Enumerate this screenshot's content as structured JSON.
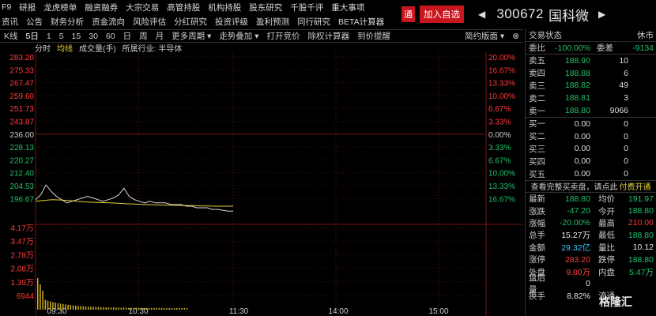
{
  "menu": {
    "row1": [
      "F9",
      "研报",
      "龙虎榜单",
      "融资融券",
      "大宗交易",
      "高管持股",
      "机构持股",
      "股东研究",
      "千股千评",
      "重大事项"
    ],
    "row2": [
      "资讯",
      "公告",
      "财务分析",
      "资金流向",
      "风险评估",
      "分红研究",
      "投资评级",
      "盈利预测",
      "同行研究",
      "BETA计算器"
    ]
  },
  "title": {
    "tong": "通",
    "add": "加入自选",
    "left_arrow": "◀",
    "right_arrow": "▶",
    "code": "300672",
    "name": "国科微"
  },
  "toolbar": {
    "items": [
      "K线",
      "5日",
      "1",
      "5",
      "15",
      "30",
      "60",
      "日",
      "周",
      "月",
      "更多周期 ▾",
      "走势叠加 ▾",
      "打开竞价",
      "除权计算器",
      "到价提醒"
    ],
    "layout": "简约版面 ▾",
    "close": "⊗"
  },
  "subbar": {
    "items": [
      "分时",
      "均线",
      "成交量(手)",
      "所属行业: 半导体"
    ]
  },
  "chart_data": {
    "type": "line",
    "y_ticks": [
      "283.20",
      "275.33",
      "267.47",
      "259.60",
      "251.73",
      "243.87",
      "236.00",
      "228.13",
      "220.27",
      "212.40",
      "204.53",
      "196.67"
    ],
    "pct_ticks": [
      "20.00%",
      "16.67%",
      "13.33%",
      "10.00%",
      "6.67%",
      "3.33%",
      "0.00%",
      "3.33%",
      "6.67%",
      "10.00%",
      "13.33%",
      "16.67%"
    ],
    "vol_ticks": [
      "4.17万",
      "3.47万",
      "2.78万",
      "2.08万",
      "1.39万",
      "6944"
    ],
    "x_ticks": [
      "09:30",
      "10:30",
      "11:30",
      "14:00",
      "15:00"
    ],
    "prev_close": 236.0,
    "ylim": [
      188.8,
      283.2
    ],
    "price": [
      196,
      199,
      205,
      201,
      198,
      196,
      194,
      195,
      196,
      197,
      198,
      197,
      196,
      195,
      196,
      197,
      199,
      203,
      198,
      196,
      195,
      194,
      195,
      194,
      194,
      194,
      193,
      193,
      193,
      192,
      192,
      191,
      191,
      191,
      190,
      190,
      189.5,
      189,
      189
    ],
    "avg": [
      195,
      195.5,
      196,
      195.8,
      195.5,
      195,
      194.6,
      194.4,
      194.2,
      194,
      193.8,
      193.5,
      193.3,
      193.1,
      192.9,
      192.7,
      192.6,
      192.5,
      192.4,
      192.3,
      192.2,
      192.1,
      192.0,
      192.0,
      191.97
    ],
    "volume_max": 41700
  },
  "rp": {
    "title": "交易状态",
    "status": "休市",
    "ratio_label": "委比",
    "ratio": "-100.00%",
    "diff_label": "委差",
    "diff": "-9134",
    "sells": [
      {
        "k": "卖五",
        "p": "188.90",
        "q": "10"
      },
      {
        "k": "卖四",
        "p": "188.88",
        "q": "6"
      },
      {
        "k": "卖三",
        "p": "188.82",
        "q": "49"
      },
      {
        "k": "卖二",
        "p": "188.81",
        "q": "3"
      },
      {
        "k": "卖一",
        "p": "188.80",
        "q": "9066"
      }
    ],
    "buys": [
      {
        "k": "买一",
        "p": "0.00",
        "q": "0"
      },
      {
        "k": "买二",
        "p": "0.00",
        "q": "0"
      },
      {
        "k": "买三",
        "p": "0.00",
        "q": "0"
      },
      {
        "k": "买四",
        "p": "0.00",
        "q": "0"
      },
      {
        "k": "买五",
        "p": "0.00",
        "q": "0"
      }
    ],
    "full_text": "查看完整买卖盘，请点此",
    "full_link": "付费开通",
    "stats": [
      {
        "k": "最新",
        "v": "188.80",
        "c": "grn",
        "k2": "均价",
        "v2": "191.97",
        "c2": "grn"
      },
      {
        "k": "涨跌",
        "v": "-47.20",
        "c": "grn",
        "k2": "今开",
        "v2": "188.80",
        "c2": "grn"
      },
      {
        "k": "涨幅",
        "v": "-20.00%",
        "c": "grn",
        "k2": "最高",
        "v2": "210.00",
        "c2": "red"
      },
      {
        "k": "总手",
        "v": "15.27万",
        "c": "wht",
        "k2": "最低",
        "v2": "188.80",
        "c2": "grn"
      },
      {
        "k": "金额",
        "v": "29.32亿",
        "c": "cy",
        "k2": "量比",
        "v2": "10.12",
        "c2": "wht"
      },
      {
        "k": "涨停",
        "v": "283.20",
        "c": "red",
        "k2": "跌停",
        "v2": "188.80",
        "c2": "grn"
      },
      {
        "k": "外盘",
        "v": "9.80万",
        "c": "red",
        "k2": "内盘",
        "v2": "5.47万",
        "c2": "grn"
      },
      {
        "k": "盘后量",
        "v": "0",
        "c": "wht",
        "k2": "",
        "v2": "",
        "c2": "wht"
      },
      {
        "k": "换手",
        "v": "8.82%",
        "c": "wht",
        "k2": "流通",
        "v2": "",
        "c2": "wht"
      }
    ],
    "watermark": "格隆汇"
  }
}
